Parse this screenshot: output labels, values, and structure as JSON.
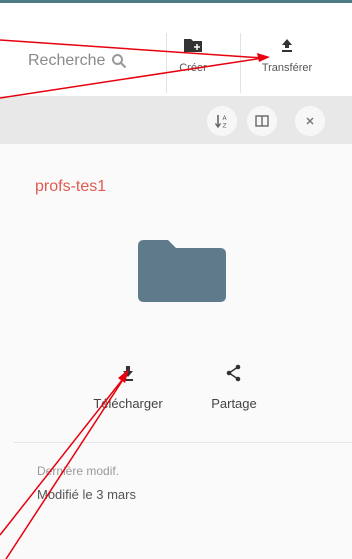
{
  "search": {
    "placeholder": "Recherche"
  },
  "toolbar": {
    "create_label": "Créer",
    "upload_label": "Transférer"
  },
  "details": {
    "folder_name": "profs-tes1",
    "download_label": "Télécharger",
    "share_label": "Partage",
    "modified_label": "Dernière modif.",
    "modified_value": "Modifié le 3 mars"
  },
  "colors": {
    "accent": "#e05a52",
    "folder": "#5f7a8a",
    "annotation": "#e8000f"
  }
}
